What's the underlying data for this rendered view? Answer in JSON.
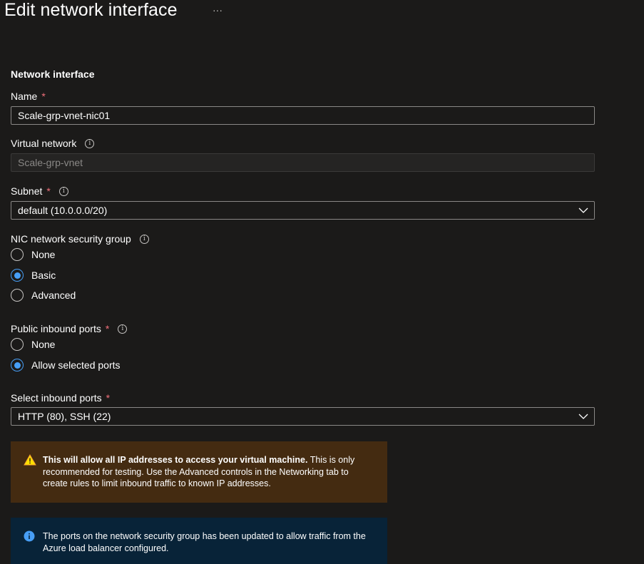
{
  "header": {
    "title": "Edit network interface",
    "more": "···"
  },
  "section": {
    "title": "Network interface"
  },
  "name": {
    "label": "Name",
    "required": "*",
    "value": "Scale-grp-vnet-nic01"
  },
  "vnet": {
    "label": "Virtual network",
    "value": "Scale-grp-vnet"
  },
  "subnet": {
    "label": "Subnet",
    "required": "*",
    "value": "default (10.0.0.0/20)"
  },
  "nsg": {
    "label": "NIC network security group",
    "options": [
      "None",
      "Basic",
      "Advanced"
    ],
    "selected": "Basic"
  },
  "public_ports": {
    "label": "Public inbound ports",
    "required": "*",
    "options": [
      "None",
      "Allow selected ports"
    ],
    "selected": "Allow selected ports"
  },
  "inbound_ports": {
    "label": "Select inbound ports",
    "required": "*",
    "value": "HTTP (80), SSH (22)"
  },
  "warning": {
    "bold": "This will allow all IP addresses to access your virtual machine.",
    "text": "  This is only recommended for testing.  Use the Advanced controls in the Networking tab to create rules to limit inbound traffic to known IP addresses."
  },
  "info": {
    "text": "The ports on the network security group has been updated to allow traffic from the Azure load balancer configured."
  },
  "colors": {
    "accent": "#479ef5",
    "required": "#f1707b",
    "warning_bg": "#442b11",
    "info_bg": "#082338"
  }
}
